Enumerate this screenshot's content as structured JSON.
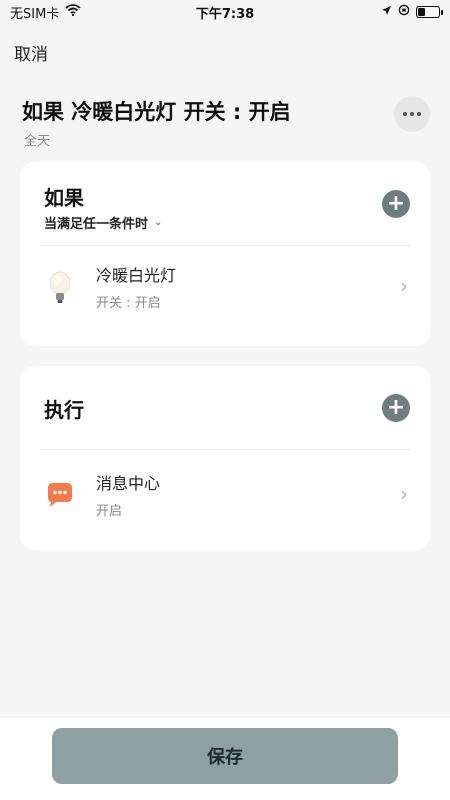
{
  "status_bar": {
    "carrier": "无SIM卡",
    "time": "下午7:38"
  },
  "header": {
    "cancel_label": "取消",
    "title": "如果 冷暖白光灯 开关 : 开启",
    "subtitle": "全天"
  },
  "if_card": {
    "title": "如果",
    "condition_mode": "当满足任一条件时",
    "items": [
      {
        "name": "冷暖白光灯",
        "state": "开关 : 开启",
        "icon": "lightbulb-icon"
      }
    ]
  },
  "do_card": {
    "title": "执行",
    "items": [
      {
        "name": "消息中心",
        "state": "开启",
        "icon": "message-bubble-icon"
      }
    ]
  },
  "footer": {
    "save_label": "保存"
  },
  "colors": {
    "accent_button": "#6e7e80",
    "save_button": "#8fa0a2",
    "message_icon": "#f07b4b"
  }
}
